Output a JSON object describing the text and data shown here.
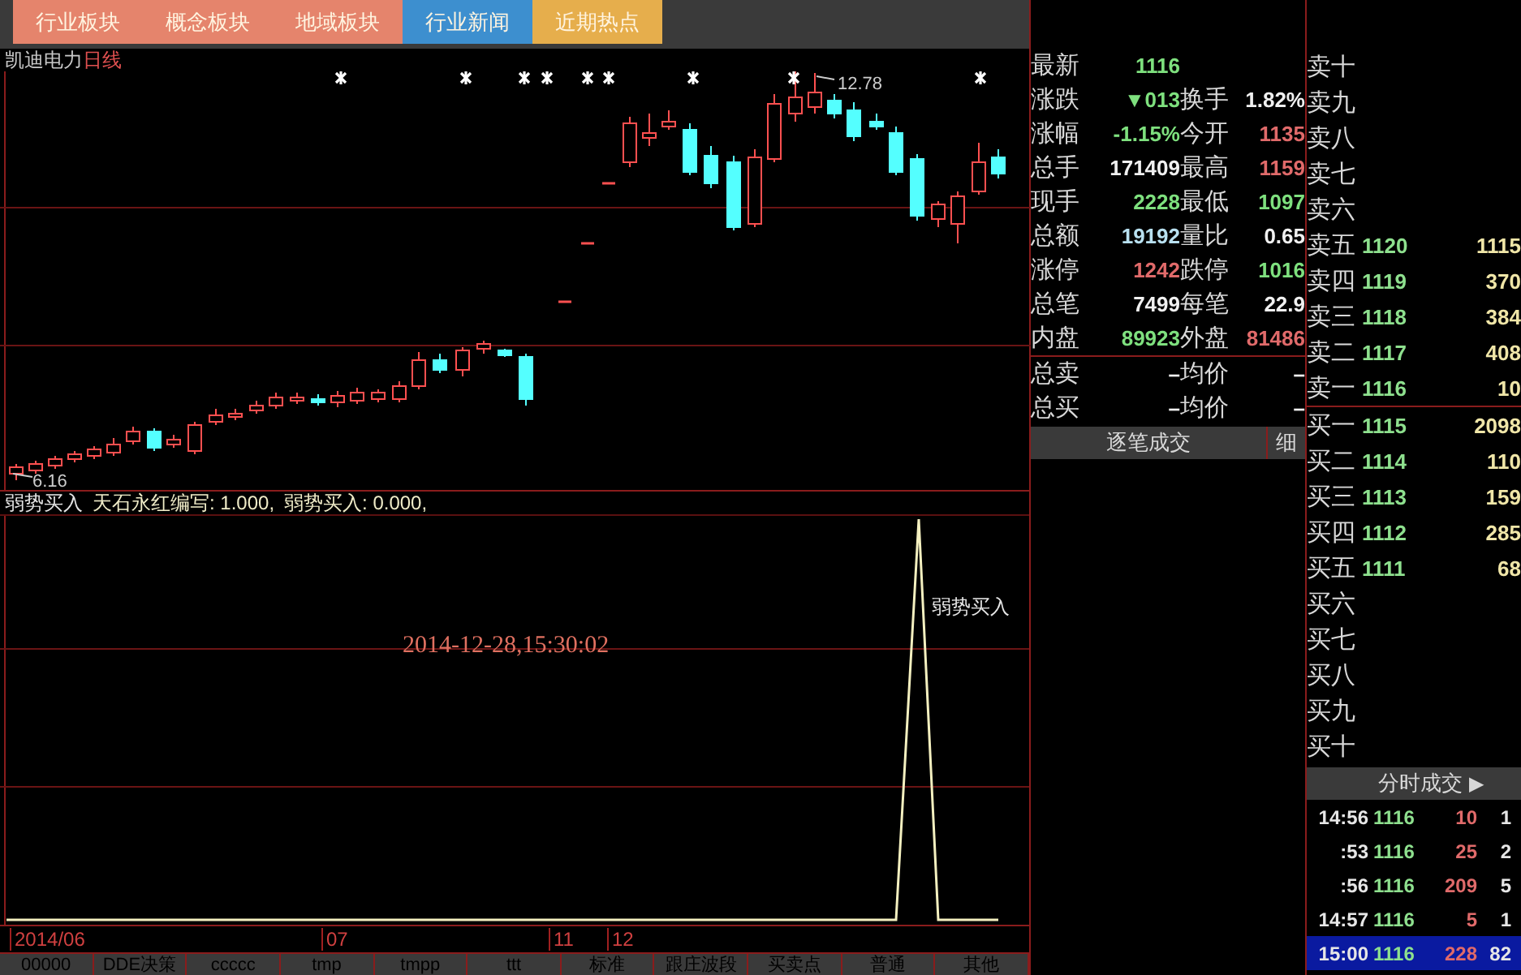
{
  "top_tabs": [
    {
      "label": "行业板块",
      "color": "#e5846c"
    },
    {
      "label": "概念板块",
      "color": "#e5846c"
    },
    {
      "label": "地域板块",
      "color": "#e5846c"
    },
    {
      "label": "行业新闻",
      "color": "#3d8fcf"
    },
    {
      "label": "近期热点",
      "color": "#e6ae4c"
    }
  ],
  "price_chart": {
    "stock_name": "凯迪电力",
    "period": "日线",
    "high_label": "12.78",
    "low_label": "6.16"
  },
  "indicator": {
    "name": "弱势买入",
    "legend": [
      "天石永红编写: 1.000,",
      "弱势买入: 0.000,"
    ],
    "signal_label": "弱势买入",
    "timestamp": "2014-12-28,15:30:02"
  },
  "date_axis": [
    "2014/06",
    "07",
    "11",
    "12"
  ],
  "bottom_tabs": [
    "00000",
    "DDE决策",
    "ccccc",
    "tmp",
    "tmpp",
    "ttt",
    "标准",
    "跟庄波段",
    "买卖点",
    "普通",
    "其他"
  ],
  "quote": [
    {
      "left": {
        "label": "最新",
        "value": "1116",
        "color": "#7ee07e"
      }
    },
    {
      "left": {
        "label": "涨跌",
        "value": "▼013",
        "color": "#7ee07e"
      },
      "right": {
        "label": "换手",
        "value": "1.82%",
        "color": "#f0f0f0"
      }
    },
    {
      "left": {
        "label": "涨幅",
        "value": "-1.15%",
        "color": "#7ee07e"
      },
      "right": {
        "label": "今开",
        "value": "1135",
        "color": "#e06a6a"
      }
    },
    {
      "left": {
        "label": "总手",
        "value": "171409",
        "color": "#f0f0f0"
      },
      "right": {
        "label": "最高",
        "value": "1159",
        "color": "#e06a6a"
      }
    },
    {
      "left": {
        "label": "现手",
        "value": "2228",
        "color": "#7ee07e"
      },
      "right": {
        "label": "最低",
        "value": "1097",
        "color": "#7ee07e"
      }
    },
    {
      "left": {
        "label": "总额",
        "value": "19192",
        "color": "#b8e0f0"
      },
      "right": {
        "label": "量比",
        "value": "0.65",
        "color": "#f0f0f0"
      }
    },
    {
      "left": {
        "label": "涨停",
        "value": "1242",
        "color": "#e06a6a"
      },
      "right": {
        "label": "跌停",
        "value": "1016",
        "color": "#7ee07e"
      }
    },
    {
      "left": {
        "label": "总笔",
        "value": "7499",
        "color": "#f0f0f0"
      },
      "right": {
        "label": "每笔",
        "value": "22.9",
        "color": "#f0f0f0"
      }
    },
    {
      "left": {
        "label": "内盘",
        "value": "89923",
        "color": "#7ee07e"
      },
      "right": {
        "label": "外盘",
        "value": "81486",
        "color": "#e06a6a"
      }
    },
    {
      "left": {
        "label": "总卖",
        "value": "–",
        "color": "#f0f0f0"
      },
      "right": {
        "label": "均价",
        "value": "–",
        "color": "#f0f0f0"
      }
    },
    {
      "left": {
        "label": "总买",
        "value": "–",
        "color": "#f0f0f0"
      },
      "right": {
        "label": "均价",
        "value": "–",
        "color": "#f0f0f0"
      }
    }
  ],
  "tick_header": {
    "title": "逐笔成交",
    "detail_button": "细"
  },
  "order_book": {
    "asks": [
      {
        "label": "卖十"
      },
      {
        "label": "卖九"
      },
      {
        "label": "卖八"
      },
      {
        "label": "卖七"
      },
      {
        "label": "卖六"
      },
      {
        "label": "卖五",
        "price": "1120",
        "volume": "1115"
      },
      {
        "label": "卖四",
        "price": "1119",
        "volume": "370"
      },
      {
        "label": "卖三",
        "price": "1118",
        "volume": "384"
      },
      {
        "label": "卖二",
        "price": "1117",
        "volume": "408"
      },
      {
        "label": "卖一",
        "price": "1116",
        "volume": "10"
      }
    ],
    "bids": [
      {
        "label": "买一",
        "price": "1115",
        "volume": "2098"
      },
      {
        "label": "买二",
        "price": "1114",
        "volume": "110"
      },
      {
        "label": "买三",
        "price": "1113",
        "volume": "159"
      },
      {
        "label": "买四",
        "price": "1112",
        "volume": "285"
      },
      {
        "label": "买五",
        "price": "1111",
        "volume": "68"
      },
      {
        "label": "买六"
      },
      {
        "label": "买七"
      },
      {
        "label": "买八"
      },
      {
        "label": "买九"
      },
      {
        "label": "买十"
      }
    ]
  },
  "trades_header": {
    "title": "分时成交",
    "arrow": "▶"
  },
  "trades": [
    {
      "time": "14:56",
      "price": "1116",
      "volume": "10",
      "count": "1",
      "selected": false
    },
    {
      "time": ":53",
      "price": "1116",
      "volume": "25",
      "count": "2",
      "selected": false
    },
    {
      "time": ":56",
      "price": "1116",
      "volume": "209",
      "count": "5",
      "selected": false
    },
    {
      "time": "14:57",
      "price": "1116",
      "volume": "5",
      "count": "1",
      "selected": false
    },
    {
      "time": "15:00",
      "price": "1116",
      "volume": "228",
      "count": "82",
      "selected": true
    }
  ]
}
